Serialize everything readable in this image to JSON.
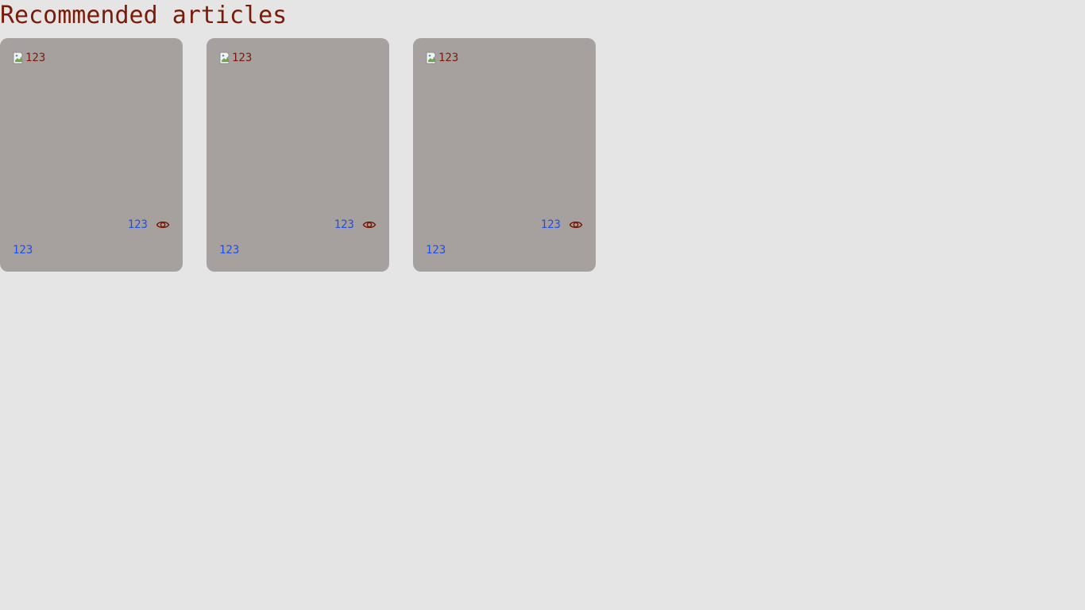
{
  "page": {
    "title": "Recommended articles"
  },
  "colors": {
    "background": "#e5e5e5",
    "card": "#a6a09f",
    "title": "#7a1a08",
    "link": "#1e4fe8"
  },
  "articles": [
    {
      "image_alt": "123",
      "views": "123",
      "title": "123",
      "views_icon": "eye-icon"
    },
    {
      "image_alt": "123",
      "views": "123",
      "title": "123",
      "views_icon": "eye-icon"
    },
    {
      "image_alt": "123",
      "views": "123",
      "title": "123",
      "views_icon": "eye-icon"
    }
  ]
}
